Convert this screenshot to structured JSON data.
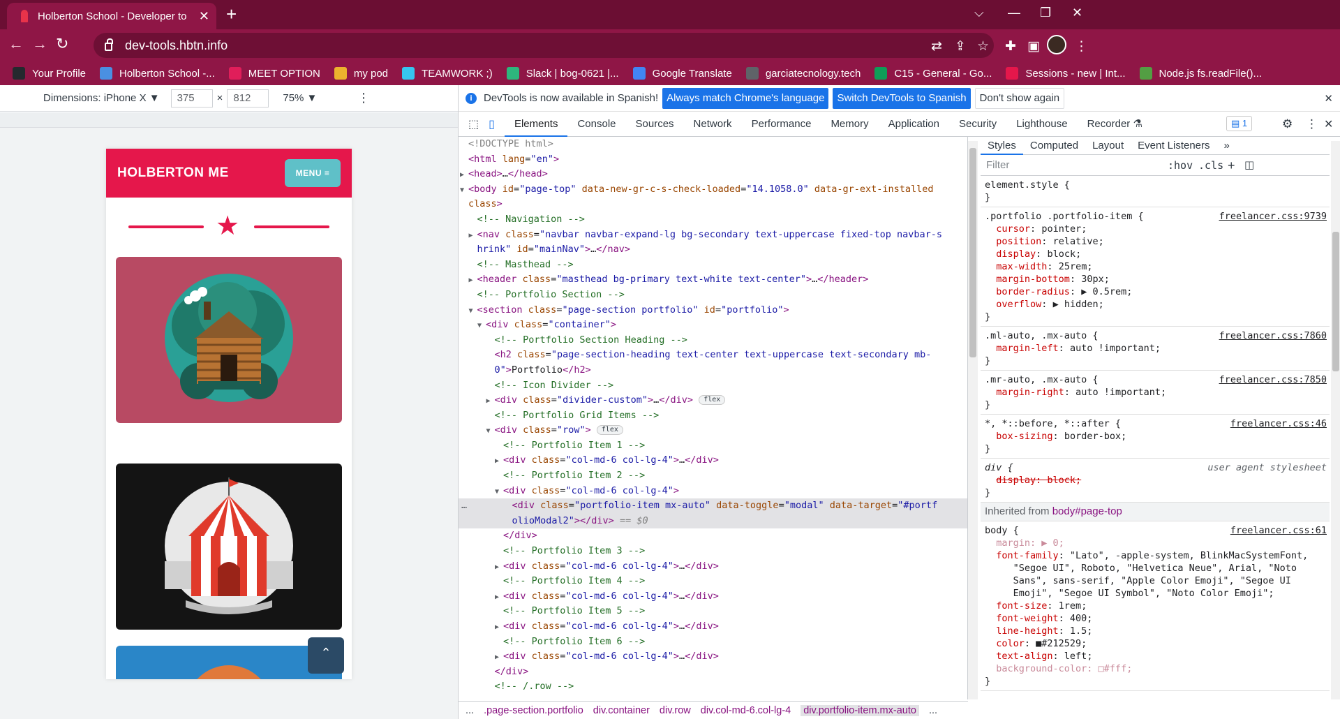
{
  "browser": {
    "tab_title": "Holberton School - Developer to",
    "tab_close": "✕",
    "new_tab": "+",
    "url": "dev-tools.hbtn.info",
    "win_min": "⌵",
    "win_minimize": "—",
    "win_restore": "❐",
    "win_close": "✕"
  },
  "bookmarks": [
    {
      "label": "Your Profile",
      "icon": "github-icon",
      "color": "#24292e"
    },
    {
      "label": "Holberton School -...",
      "icon": "calendar-icon",
      "color": "#4a90e2"
    },
    {
      "label": "MEET OPTION",
      "icon": "slack-icon",
      "color": "#e01e5a"
    },
    {
      "label": "my pod",
      "icon": "slack-icon",
      "color": "#ecb22e"
    },
    {
      "label": "TEAMWORK ;)",
      "icon": "slack-icon",
      "color": "#36c5f0"
    },
    {
      "label": "Slack | bog-0621 |...",
      "icon": "slack-icon",
      "color": "#2eb67d"
    },
    {
      "label": "Google Translate",
      "icon": "translate-icon",
      "color": "#4285f4"
    },
    {
      "label": "garciatecnology.tech",
      "icon": "globe-icon",
      "color": "#5f6368"
    },
    {
      "label": "C15 - General - Go...",
      "icon": "sheets-icon",
      "color": "#0f9d58"
    },
    {
      "label": "Sessions - new | Int...",
      "icon": "holberton-icon",
      "color": "#e5174b"
    },
    {
      "label": "Node.js fs.readFile()...",
      "icon": "nodejs-icon",
      "color": "#539e43"
    }
  ],
  "device_toolbar": {
    "dimensions_label": "Dimensions: iPhone X ▼",
    "width": "375",
    "times": "×",
    "height": "812",
    "zoom": "75% ▼",
    "more": "⋮"
  },
  "site": {
    "brand": "HOLBERTON ME",
    "menu_label": "MENU ≡",
    "star": "★",
    "scroll_top": "⌃",
    "accent": "#e5174b",
    "menu_color": "#5fc0c8"
  },
  "infobar": {
    "message": "DevTools is now available in Spanish!",
    "btn_match": "Always match Chrome's language",
    "btn_switch": "Switch DevTools to Spanish",
    "btn_dismiss": "Don't show again",
    "close": "✕"
  },
  "devtools_tabs": [
    "Elements",
    "Console",
    "Sources",
    "Network",
    "Performance",
    "Memory",
    "Application",
    "Security",
    "Lighthouse",
    "Recorder ⚗"
  ],
  "devtools_misc": {
    "issues_count": "1",
    "settings": "⚙",
    "more": "⋮",
    "close": "✕"
  },
  "dom_lines": [
    {
      "indent": 0,
      "arrow": "",
      "html": "<span class='dt'>&lt;!DOCTYPE html&gt;</span>"
    },
    {
      "indent": 0,
      "arrow": "",
      "html": "<span class='tg'>&lt;html</span> <span class='at'>lang</span>=<span class='av'>\"en\"</span><span class='tg'>&gt;</span>"
    },
    {
      "indent": 0,
      "arrow": "▶",
      "html": "<span class='tg'>&lt;head&gt;</span>…<span class='tg'>&lt;/head&gt;</span>"
    },
    {
      "indent": 0,
      "arrow": "▼",
      "html": "<span class='tg'>&lt;body</span> <span class='at'>id</span>=<span class='av'>\"page-top\"</span> <span class='at'>data-new-gr-c-s-check-loaded</span>=<span class='av'>\"14.1058.0\"</span> <span class='at'>data-gr-ext-installed</span>"
    },
    {
      "indent": 0,
      "arrow": "",
      "html": "<span class='at'>class</span><span class='tg'>&gt;</span>"
    },
    {
      "indent": 1,
      "arrow": "",
      "html": "<span class='cm'>&lt;!-- Navigation --&gt;</span>"
    },
    {
      "indent": 1,
      "arrow": "▶",
      "html": "<span class='tg'>&lt;nav</span> <span class='at'>class</span>=<span class='av'>\"navbar navbar-expand-lg bg-secondary text-uppercase fixed-top navbar-s</span>"
    },
    {
      "indent": 1,
      "arrow": "",
      "html": "<span class='av'>hrink\"</span> <span class='at'>id</span>=<span class='av'>\"mainNav\"</span><span class='tg'>&gt;</span>…<span class='tg'>&lt;/nav&gt;</span>"
    },
    {
      "indent": 1,
      "arrow": "",
      "html": "<span class='cm'>&lt;!-- Masthead --&gt;</span>"
    },
    {
      "indent": 1,
      "arrow": "▶",
      "html": "<span class='tg'>&lt;header</span> <span class='at'>class</span>=<span class='av'>\"masthead bg-primary text-white text-center\"</span><span class='tg'>&gt;</span>…<span class='tg'>&lt;/header&gt;</span>"
    },
    {
      "indent": 1,
      "arrow": "",
      "html": "<span class='cm'>&lt;!-- Portfolio Section --&gt;</span>"
    },
    {
      "indent": 1,
      "arrow": "▼",
      "html": "<span class='tg'>&lt;section</span> <span class='at'>class</span>=<span class='av'>\"page-section portfolio\"</span> <span class='at'>id</span>=<span class='av'>\"portfolio\"</span><span class='tg'>&gt;</span>"
    },
    {
      "indent": 2,
      "arrow": "▼",
      "html": "<span class='tg'>&lt;div</span> <span class='at'>class</span>=<span class='av'>\"container\"</span><span class='tg'>&gt;</span>"
    },
    {
      "indent": 3,
      "arrow": "",
      "html": "<span class='cm'>&lt;!-- Portfolio Section Heading --&gt;</span>"
    },
    {
      "indent": 3,
      "arrow": "",
      "html": "<span class='tg'>&lt;h2</span> <span class='at'>class</span>=<span class='av'>\"page-section-heading text-center text-uppercase text-secondary mb-</span>"
    },
    {
      "indent": 3,
      "arrow": "",
      "html": "<span class='av'>0\"</span><span class='tg'>&gt;</span>Portfolio<span class='tg'>&lt;/h2&gt;</span>"
    },
    {
      "indent": 3,
      "arrow": "",
      "html": "<span class='cm'>&lt;!-- Icon Divider --&gt;</span>"
    },
    {
      "indent": 3,
      "arrow": "▶",
      "html": "<span class='tg'>&lt;div</span> <span class='at'>class</span>=<span class='av'>\"divider-custom\"</span><span class='tg'>&gt;</span>…<span class='tg'>&lt;/div&gt;</span> <span class='badge'>flex</span>"
    },
    {
      "indent": 3,
      "arrow": "",
      "html": "<span class='cm'>&lt;!-- Portfolio Grid Items --&gt;</span>"
    },
    {
      "indent": 3,
      "arrow": "▼",
      "html": "<span class='tg'>&lt;div</span> <span class='at'>class</span>=<span class='av'>\"row\"</span><span class='tg'>&gt;</span> <span class='badge'>flex</span>"
    },
    {
      "indent": 4,
      "arrow": "",
      "html": "<span class='cm'>&lt;!-- Portfolio Item 1 --&gt;</span>"
    },
    {
      "indent": 4,
      "arrow": "▶",
      "html": "<span class='tg'>&lt;div</span> <span class='at'>class</span>=<span class='av'>\"col-md-6 col-lg-4\"</span><span class='tg'>&gt;</span>…<span class='tg'>&lt;/div&gt;</span>"
    },
    {
      "indent": 4,
      "arrow": "",
      "html": "<span class='cm'>&lt;!-- Portfolio Item 2 --&gt;</span>"
    },
    {
      "indent": 4,
      "arrow": "▼",
      "html": "<span class='tg'>&lt;div</span> <span class='at'>class</span>=<span class='av'>\"col-md-6 col-lg-4\"</span><span class='tg'>&gt;</span>"
    },
    {
      "indent": 5,
      "arrow": "",
      "sel": true,
      "html": "<span class='tg'>&lt;div</span> <span class='at'>class</span>=<span class='av'>\"portfolio-item mx-auto\"</span> <span class='at'>data-toggle</span>=<span class='av'>\"modal\"</span> <span class='at'>data-target</span>=<span class='av'>\"#portf</span>"
    },
    {
      "indent": 5,
      "arrow": "",
      "sel": true,
      "html": "<span class='av'>olioModal2\"</span><span class='tg'>&gt;&lt;/div&gt;</span> <span class='dt'>== <i>$0</i></span>"
    },
    {
      "indent": 4,
      "arrow": "",
      "html": "<span class='tg'>&lt;/div&gt;</span>"
    },
    {
      "indent": 4,
      "arrow": "",
      "html": "<span class='cm'>&lt;!-- Portfolio Item 3 --&gt;</span>"
    },
    {
      "indent": 4,
      "arrow": "▶",
      "html": "<span class='tg'>&lt;div</span> <span class='at'>class</span>=<span class='av'>\"col-md-6 col-lg-4\"</span><span class='tg'>&gt;</span>…<span class='tg'>&lt;/div&gt;</span>"
    },
    {
      "indent": 4,
      "arrow": "",
      "html": "<span class='cm'>&lt;!-- Portfolio Item 4 --&gt;</span>"
    },
    {
      "indent": 4,
      "arrow": "▶",
      "html": "<span class='tg'>&lt;div</span> <span class='at'>class</span>=<span class='av'>\"col-md-6 col-lg-4\"</span><span class='tg'>&gt;</span>…<span class='tg'>&lt;/div&gt;</span>"
    },
    {
      "indent": 4,
      "arrow": "",
      "html": "<span class='cm'>&lt;!-- Portfolio Item 5 --&gt;</span>"
    },
    {
      "indent": 4,
      "arrow": "▶",
      "html": "<span class='tg'>&lt;div</span> <span class='at'>class</span>=<span class='av'>\"col-md-6 col-lg-4\"</span><span class='tg'>&gt;</span>…<span class='tg'>&lt;/div&gt;</span>"
    },
    {
      "indent": 4,
      "arrow": "",
      "html": "<span class='cm'>&lt;!-- Portfolio Item 6 --&gt;</span>"
    },
    {
      "indent": 4,
      "arrow": "▶",
      "html": "<span class='tg'>&lt;div</span> <span class='at'>class</span>=<span class='av'>\"col-md-6 col-lg-4\"</span><span class='tg'>&gt;</span>…<span class='tg'>&lt;/div&gt;</span>"
    },
    {
      "indent": 3,
      "arrow": "",
      "html": "<span class='tg'>&lt;/div&gt;</span>"
    },
    {
      "indent": 3,
      "arrow": "",
      "html": "<span class='cm'>&lt;!-- /.row --&gt;</span>"
    }
  ],
  "breadcrumbs": [
    "...",
    ".page-section.portfolio",
    "div.container",
    "div.row",
    "div.col-md-6.col-lg-4",
    "div.portfolio-item.mx-auto",
    "..."
  ],
  "styles_tabs": [
    "Styles",
    "Computed",
    "Layout",
    "Event Listeners",
    "»"
  ],
  "styles_filter": {
    "placeholder": "Filter",
    "hov": ":hov",
    "cls": ".cls",
    "plus": "+"
  },
  "css_rules": [
    {
      "selector": "element.style {",
      "source": "",
      "props": [],
      "close": "}"
    },
    {
      "selector": ".portfolio .portfolio-item {",
      "source": "freelancer.css:9739",
      "props": [
        [
          "cursor",
          "pointer;"
        ],
        [
          "position",
          "relative;"
        ],
        [
          "display",
          "block;"
        ],
        [
          "max-width",
          "25rem;"
        ],
        [
          "margin-bottom",
          "30px;"
        ],
        [
          "border-radius",
          "▶ 0.5rem;"
        ],
        [
          "overflow",
          "▶ hidden;"
        ]
      ],
      "close": "}"
    },
    {
      "selector": ".ml-auto, .mx-auto {",
      "source": "freelancer.css:7860",
      "props": [
        [
          "margin-left",
          "auto !important;"
        ]
      ],
      "close": "}"
    },
    {
      "selector": ".mr-auto, .mx-auto {",
      "source": "freelancer.css:7850",
      "props": [
        [
          "margin-right",
          "auto !important;"
        ]
      ],
      "close": "}"
    },
    {
      "selector": "*, *::before, *::after {",
      "source": "freelancer.css:46",
      "props": [
        [
          "box-sizing",
          "border-box;"
        ]
      ],
      "close": "}"
    }
  ],
  "ua_rule": {
    "selector": "div {",
    "source": "user agent stylesheet",
    "prop": "display: block;",
    "close": "}"
  },
  "inherited": {
    "label": "Inherited from",
    "element": "body#page-top"
  },
  "body_rule": {
    "selector": "body {",
    "source": "freelancer.css:61",
    "lines": [
      "  margin: ▶ 0;",
      "  font-family: \"Lato\", -apple-system, BlinkMacSystemFont,",
      "     \"Segoe UI\", Roboto, \"Helvetica Neue\", Arial, \"Noto",
      "     Sans\", sans-serif, \"Apple Color Emoji\", \"Segoe UI",
      "     Emoji\", \"Segoe UI Symbol\", \"Noto Color Emoji\";",
      "  font-size: 1rem;",
      "  font-weight: 400;",
      "  line-height: 1.5;",
      "  color: ■#212529;",
      "  text-align: left;",
      "  background-color: □#fff;"
    ],
    "close": "}"
  }
}
